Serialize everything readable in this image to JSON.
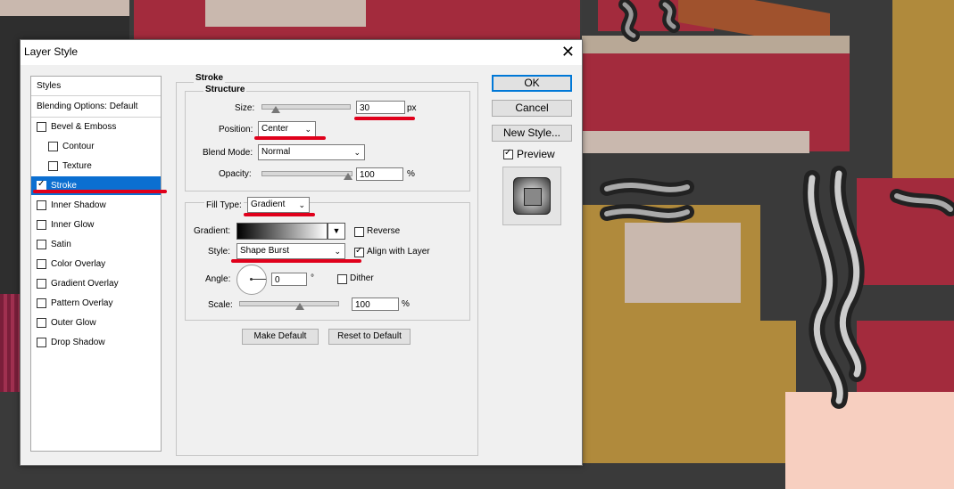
{
  "dialog": {
    "title": "Layer Style",
    "close_glyph": "✕"
  },
  "styles_panel": {
    "header": "Styles",
    "blending": "Blending Options: Default",
    "items": [
      {
        "label": "Bevel & Emboss",
        "checked": false
      },
      {
        "label": "Contour",
        "checked": false
      },
      {
        "label": "Texture",
        "checked": false
      },
      {
        "label": "Stroke",
        "checked": true
      },
      {
        "label": "Inner Shadow",
        "checked": false
      },
      {
        "label": "Inner Glow",
        "checked": false
      },
      {
        "label": "Satin",
        "checked": false
      },
      {
        "label": "Color Overlay",
        "checked": false
      },
      {
        "label": "Gradient Overlay",
        "checked": false
      },
      {
        "label": "Pattern Overlay",
        "checked": false
      },
      {
        "label": "Outer Glow",
        "checked": false
      },
      {
        "label": "Drop Shadow",
        "checked": false
      }
    ]
  },
  "stroke": {
    "section": "Stroke",
    "structure": "Structure",
    "size_label": "Size:",
    "size_value": "30",
    "size_unit": "px",
    "position_label": "Position:",
    "position_value": "Center",
    "blend_label": "Blend Mode:",
    "blend_value": "Normal",
    "opacity_label": "Opacity:",
    "opacity_value": "100",
    "opacity_unit": "%",
    "fill_type_label": "Fill Type:",
    "fill_type_value": "Gradient",
    "gradient_label": "Gradient:",
    "reverse_label": "Reverse",
    "style_label": "Style:",
    "style_value": "Shape Burst",
    "align_label": "Align with Layer",
    "angle_label": "Angle:",
    "angle_value": "0",
    "angle_unit": "°",
    "dither_label": "Dither",
    "scale_label": "Scale:",
    "scale_value": "100",
    "scale_unit": "%",
    "make_default": "Make Default",
    "reset_default": "Reset to Default"
  },
  "buttons": {
    "ok": "OK",
    "cancel": "Cancel",
    "new_style": "New Style...",
    "preview": "Preview"
  },
  "colors": {
    "selection": "#0b6fd1",
    "annotation_red": "#e0001b",
    "dialog_bg": "#f0f0f0"
  }
}
